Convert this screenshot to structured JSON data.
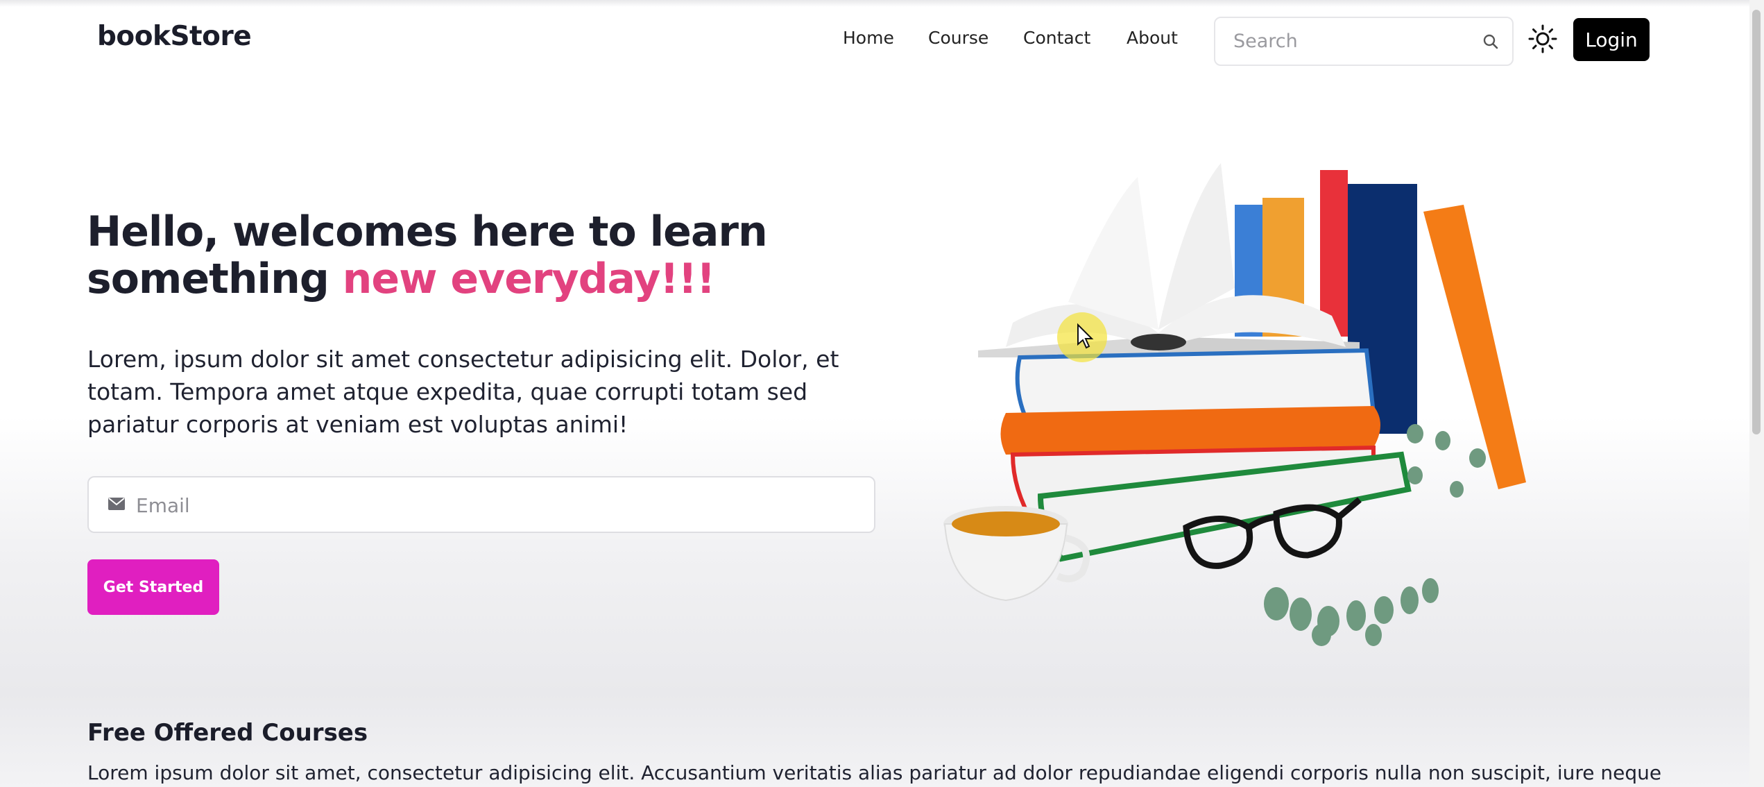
{
  "brand": "bookStore",
  "nav": {
    "items": [
      "Home",
      "Course",
      "Contact",
      "About"
    ]
  },
  "search": {
    "placeholder": "Search",
    "icon": "search-icon"
  },
  "theme_toggle_icon": "sun-icon",
  "login_label": "Login",
  "hero": {
    "title_part1": "Hello, welcomes here to learn something ",
    "title_accent": "new everyday!!!",
    "accent_color": "#e2427f",
    "description": "Lorem, ipsum dolor sit amet consectetur adipisicing elit. Dolor, et totam. Tempora amet atque expedita, quae corrupti totam sed pariatur corporis at veniam est voluptas animi!",
    "email_placeholder": "Email",
    "email_icon": "mail-icon",
    "cta_label": "Get Started",
    "cta_color": "#e01fc0"
  },
  "courses": {
    "title": "Free Offered Courses",
    "description": "Lorem ipsum dolor sit amet, consectetur adipisicing elit. Accusantium veritatis alias pariatur ad dolor repudiandae eligendi corporis nulla non suscipit, iure neque"
  }
}
